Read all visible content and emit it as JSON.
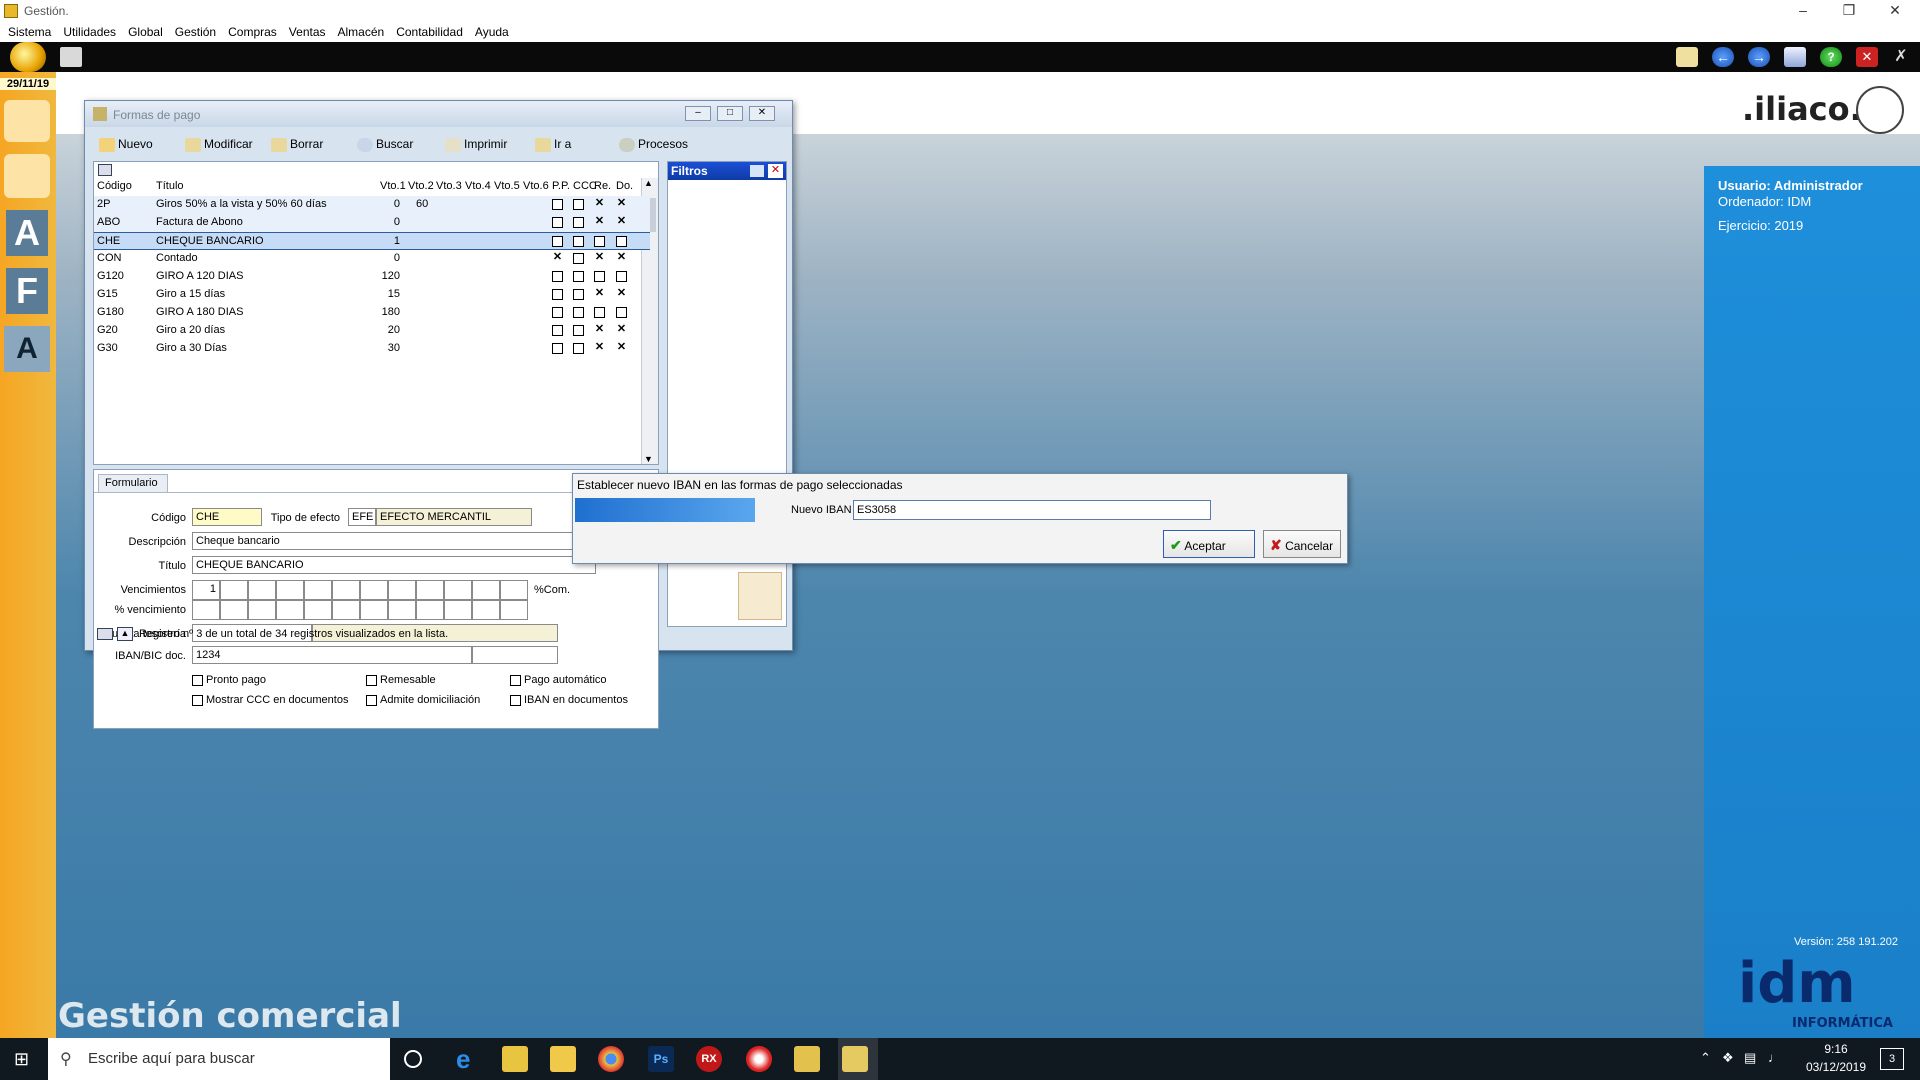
{
  "window": {
    "title": "Gestión."
  },
  "menu": [
    "Sistema",
    "Utilidades",
    "Global",
    "Gestión",
    "Compras",
    "Ventas",
    "Almacén",
    "Contabilidad",
    "Ayuda"
  ],
  "date": "29/11/19",
  "brand": {
    "logo_text": ".iliaco.",
    "footer_text": "Gestión comercial",
    "idm_text": "idm",
    "idm_sub": "INFORMÁTICA",
    "version": "Versión: 258 191.202"
  },
  "user_info": {
    "usuario": "Usuario: Administrador",
    "ordenador": "Ordenador:  IDM",
    "ejercicio": "Ejercicio: 2019"
  },
  "form_window": {
    "title": "Formas de pago",
    "toolbar": [
      "Nuevo",
      "Modificar",
      "Borrar",
      "Buscar",
      "Imprimir",
      "Ir a",
      "Procesos"
    ],
    "filtros_title": "Filtros",
    "columns": [
      "Código",
      "Título",
      "Vto.1",
      "Vto.2",
      "Vto.3",
      "Vto.4",
      "Vto.5",
      "Vto.6",
      "P.P.",
      "CCC",
      "Re.",
      "Do."
    ],
    "rows": [
      {
        "code": "2P",
        "title": "Giros 50% a la vista y 50% 60 días",
        "v1": "0",
        "v2": "60",
        "flags": [
          false,
          false,
          true,
          true
        ]
      },
      {
        "code": "ABO",
        "title": "Factura de Abono",
        "v1": "0",
        "v2": "",
        "flags": [
          false,
          false,
          true,
          true
        ]
      },
      {
        "code": "CHE",
        "title": "CHEQUE BANCARIO",
        "v1": "1",
        "v2": "",
        "flags": [
          false,
          false,
          false,
          false
        ]
      },
      {
        "code": "CON",
        "title": "Contado",
        "v1": "0",
        "v2": "",
        "flags": [
          true,
          false,
          true,
          true
        ]
      },
      {
        "code": "G120",
        "title": "GIRO A 120 DIAS",
        "v1": "120",
        "v2": "",
        "flags": [
          false,
          false,
          false,
          false
        ]
      },
      {
        "code": "G15",
        "title": "Giro a 15 días",
        "v1": "15",
        "v2": "",
        "flags": [
          false,
          false,
          true,
          true
        ]
      },
      {
        "code": "G180",
        "title": "GIRO A 180 DIAS",
        "v1": "180",
        "v2": "",
        "flags": [
          false,
          false,
          false,
          false
        ]
      },
      {
        "code": "G20",
        "title": "Giro a 20 días",
        "v1": "20",
        "v2": "",
        "flags": [
          false,
          false,
          true,
          true
        ]
      },
      {
        "code": "G30",
        "title": "Giro a 30 Días",
        "v1": "30",
        "v2": "",
        "flags": [
          false,
          false,
          true,
          true
        ]
      }
    ],
    "form_tab": "Formulario",
    "labels": {
      "codigo": "Código",
      "tipo_efecto": "Tipo de efecto",
      "descripcion": "Descripción",
      "titulo": "Título",
      "vencimientos": "Vencimientos",
      "pct_venc": "% vencimiento",
      "pct_com": "%Com.",
      "cuenta": "Cuenta tesorería",
      "iban": "IBAN/BIC doc."
    },
    "values": {
      "codigo": "CHE",
      "tipo_code": "EFE",
      "tipo_desc": "EFECTO MERCANTIL",
      "descripcion": "Cheque bancario",
      "titulo": "CHEQUE BANCARIO",
      "venc1": "1",
      "iban": "1234"
    },
    "checkboxes": [
      "Pronto pago",
      "Remesable",
      "Pago automático",
      "Mostrar CCC en documentos",
      "Admite domiciliación",
      "IBAN en documentos"
    ],
    "status": "Registro nº 3 de un total de 34 registros visualizados en la lista."
  },
  "dialog": {
    "title": "Establecer nuevo IBAN en las formas de pago seleccionadas",
    "field_label": "Nuevo IBAN",
    "field_value": "ES3058",
    "ok": "Aceptar",
    "cancel": "Cancelar"
  },
  "taskbar": {
    "search_placeholder": "Escribe aquí para buscar",
    "time": "9:16",
    "date": "03/12/2019",
    "notif": "3"
  }
}
